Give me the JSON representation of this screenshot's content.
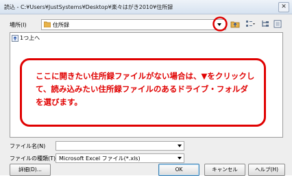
{
  "window": {
    "title": "読込 - C:¥Users¥JustSystems¥Desktop¥楽々はがき2010¥住所録",
    "close_label": "✕"
  },
  "location": {
    "label": "場所(I)",
    "value": "住所録"
  },
  "file_list": {
    "up_item": "1つ上へ"
  },
  "callout": {
    "text": "ここに開きたい住所録ファイルがない場合は、▼をクリックして、読み込みたい住所録ファイルのあるドライブ・フォルダを選びます。"
  },
  "filename": {
    "label": "ファイル名(N)",
    "value": ""
  },
  "filetype": {
    "label": "ファイルの種類(T)",
    "value": "Microsoft Excel ファイル(*.xls)"
  },
  "buttons": {
    "details": "詳細(D)...",
    "ok": "OK",
    "cancel": "キャンセル",
    "help": "ヘルプ(H)"
  },
  "colors": {
    "annotation": "#e00000",
    "folder": "#e8b34a"
  }
}
